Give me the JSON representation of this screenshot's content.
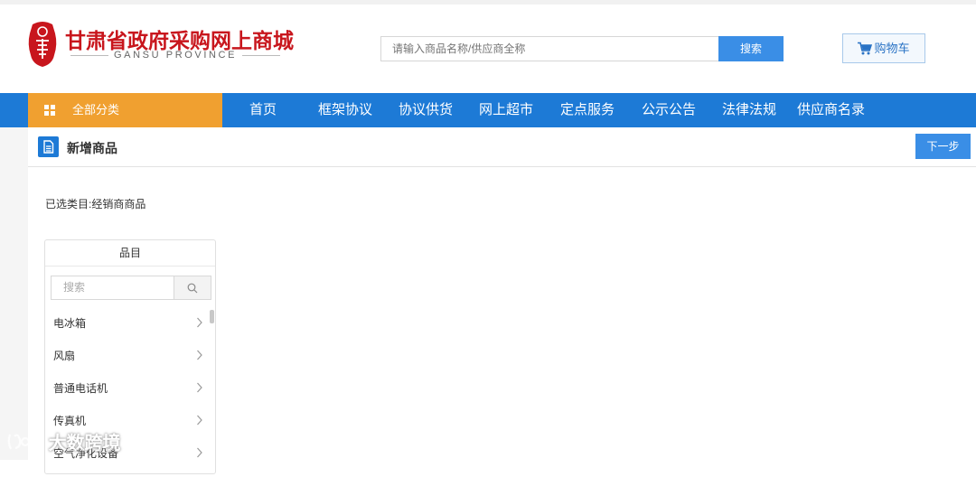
{
  "header": {
    "logo_title": "甘肃省政府采购网上商城",
    "logo_subtitle": "GANSU PROVINCE",
    "search_placeholder": "请输入商品名称/供应商全称",
    "search_button": "搜索",
    "cart_label": "购物车"
  },
  "nav": {
    "all_categories": "全部分类",
    "items": [
      "首页",
      "框架协议",
      "协议供货",
      "网上超市",
      "定点服务",
      "公示公告",
      "法律法规",
      "供应商名录"
    ]
  },
  "page": {
    "title": "新增商品",
    "next_button": "下一步",
    "selected_category": "已选类目:经销商商品"
  },
  "category_panel": {
    "header": "品目",
    "search_placeholder": "搜索",
    "items": [
      "电冰箱",
      "风扇",
      "普通电话机",
      "传真机",
      "空气净化设备"
    ]
  },
  "watermark": "大数跨境",
  "colors": {
    "primary_blue": "#1d7ad6",
    "button_blue": "#3a8ee6",
    "category_orange": "#f0a030",
    "logo_red": "#c8161d"
  }
}
